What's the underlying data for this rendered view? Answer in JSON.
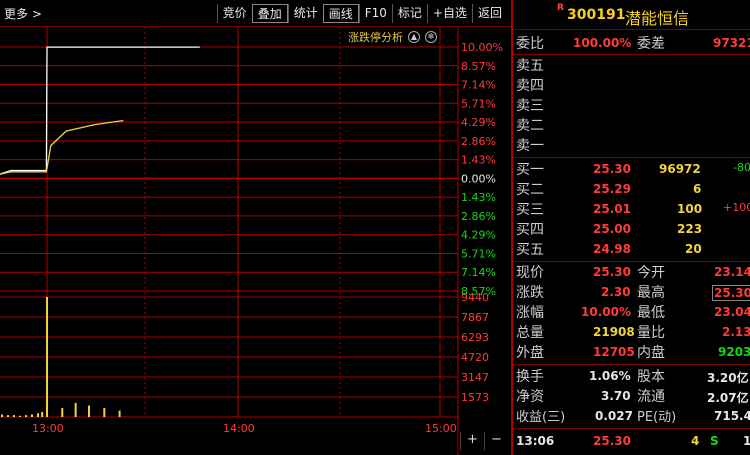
{
  "toolbar": {
    "more_label": "更多 >",
    "buttons": [
      "竞价",
      "叠加",
      "统计",
      "画线",
      "F10",
      "标记",
      "+自选",
      "返回"
    ]
  },
  "chart": {
    "analysis_label": "涨跌停分析",
    "analysis_icon": "gear-icon",
    "y_percent_labels": [
      "10.00%",
      "8.57%",
      "7.14%",
      "5.71%",
      "4.29%",
      "2.86%",
      "1.43%",
      "0.00%",
      "1.43%",
      "2.86%",
      "4.29%",
      "5.71%",
      "7.14%",
      "8.57%"
    ],
    "volume_labels": [
      "9440",
      "7867",
      "6293",
      "4720",
      "3147",
      "1573"
    ],
    "time_labels": [
      "13:00",
      "14:00",
      "15:00"
    ],
    "zoom_in": "+",
    "zoom_out": "−",
    "colors": {
      "grid": "#b00000",
      "price_line": "#ffffff",
      "avg_line": "#f2d43c",
      "axis_red": "#ff3b3b",
      "axis_green": "#17d617",
      "zero": "#e6e6e6"
    }
  },
  "chart_data": {
    "type": "line",
    "series": [
      {
        "x": [
          0,
          0.2,
          0.4,
          0.7,
          0.79,
          0.8,
          0.85,
          1.0,
          1.6
        ],
        "values": [
          0.3,
          0.6,
          0.6,
          0.6,
          0.6,
          10.0,
          10.0,
          10.0,
          10.0
        ]
      },
      {
        "x": [
          0,
          0.2,
          0.4,
          0.7,
          0.79,
          0.82,
          0.9,
          1.05,
          1.15,
          1.2
        ],
        "values": [
          0.3,
          0.5,
          0.5,
          0.5,
          0.5,
          2.5,
          3.6,
          4.1,
          4.3,
          4.4
        ]
      }
    ],
    "volume": {
      "x": [
        0.05,
        0.15,
        0.25,
        0.35,
        0.45,
        0.55,
        0.65,
        0.72,
        0.8,
        0.88,
        0.95,
        1.02,
        1.1,
        1.18
      ],
      "values": [
        200,
        150,
        150,
        100,
        150,
        200,
        300,
        400,
        9440,
        700,
        1100,
        900,
        700,
        500
      ]
    },
    "ylim": [
      -10,
      10
    ],
    "volume_max": 9440
  },
  "quote": {
    "r_mark": "R",
    "code": "300191",
    "name": "潜能恒信",
    "wei_bi_label": "委比",
    "wei_bi_value": "100.00%",
    "wei_cha_label": "委差",
    "wei_cha_value": "97321",
    "sell": [
      {
        "label": "卖五"
      },
      {
        "label": "卖四"
      },
      {
        "label": "卖三"
      },
      {
        "label": "卖二"
      },
      {
        "label": "卖一"
      }
    ],
    "buy": [
      {
        "label": "买一",
        "price": "25.30",
        "vol": "96972",
        "chg": "-80"
      },
      {
        "label": "买二",
        "price": "25.29",
        "vol": "6",
        "chg": ""
      },
      {
        "label": "买三",
        "price": "25.01",
        "vol": "100",
        "chg": "+100"
      },
      {
        "label": "买四",
        "price": "25.00",
        "vol": "223",
        "chg": ""
      },
      {
        "label": "买五",
        "price": "24.98",
        "vol": "20",
        "chg": ""
      }
    ],
    "stats": [
      {
        "l1": "现价",
        "v1": "25.30",
        "l2": "今开",
        "v2": "23.14"
      },
      {
        "l1": "涨跌",
        "v1": "2.30",
        "l2": "最高",
        "v2": "25.30"
      },
      {
        "l1": "涨幅",
        "v1": "10.00%",
        "l2": "最低",
        "v2": "23.04"
      },
      {
        "l1": "总量",
        "v1": "21908",
        "l2": "量比",
        "v2": "2.13"
      },
      {
        "l1": "外盘",
        "v1": "12705",
        "l2": "内盘",
        "v2": "9203"
      }
    ],
    "stats2": [
      {
        "l1": "换手",
        "v1": "1.06%",
        "l2": "股本",
        "v2": "3.20亿"
      },
      {
        "l1": "净资",
        "v1": "3.70",
        "l2": "流通",
        "v2": "2.07亿"
      },
      {
        "l1": "收益(三)",
        "v1": "0.027",
        "l2": "PE(动)",
        "v2": "715.4"
      }
    ],
    "tick": {
      "time": "13:06",
      "price": "25.30",
      "vol": "4",
      "side": "S",
      "extra": "1"
    }
  }
}
